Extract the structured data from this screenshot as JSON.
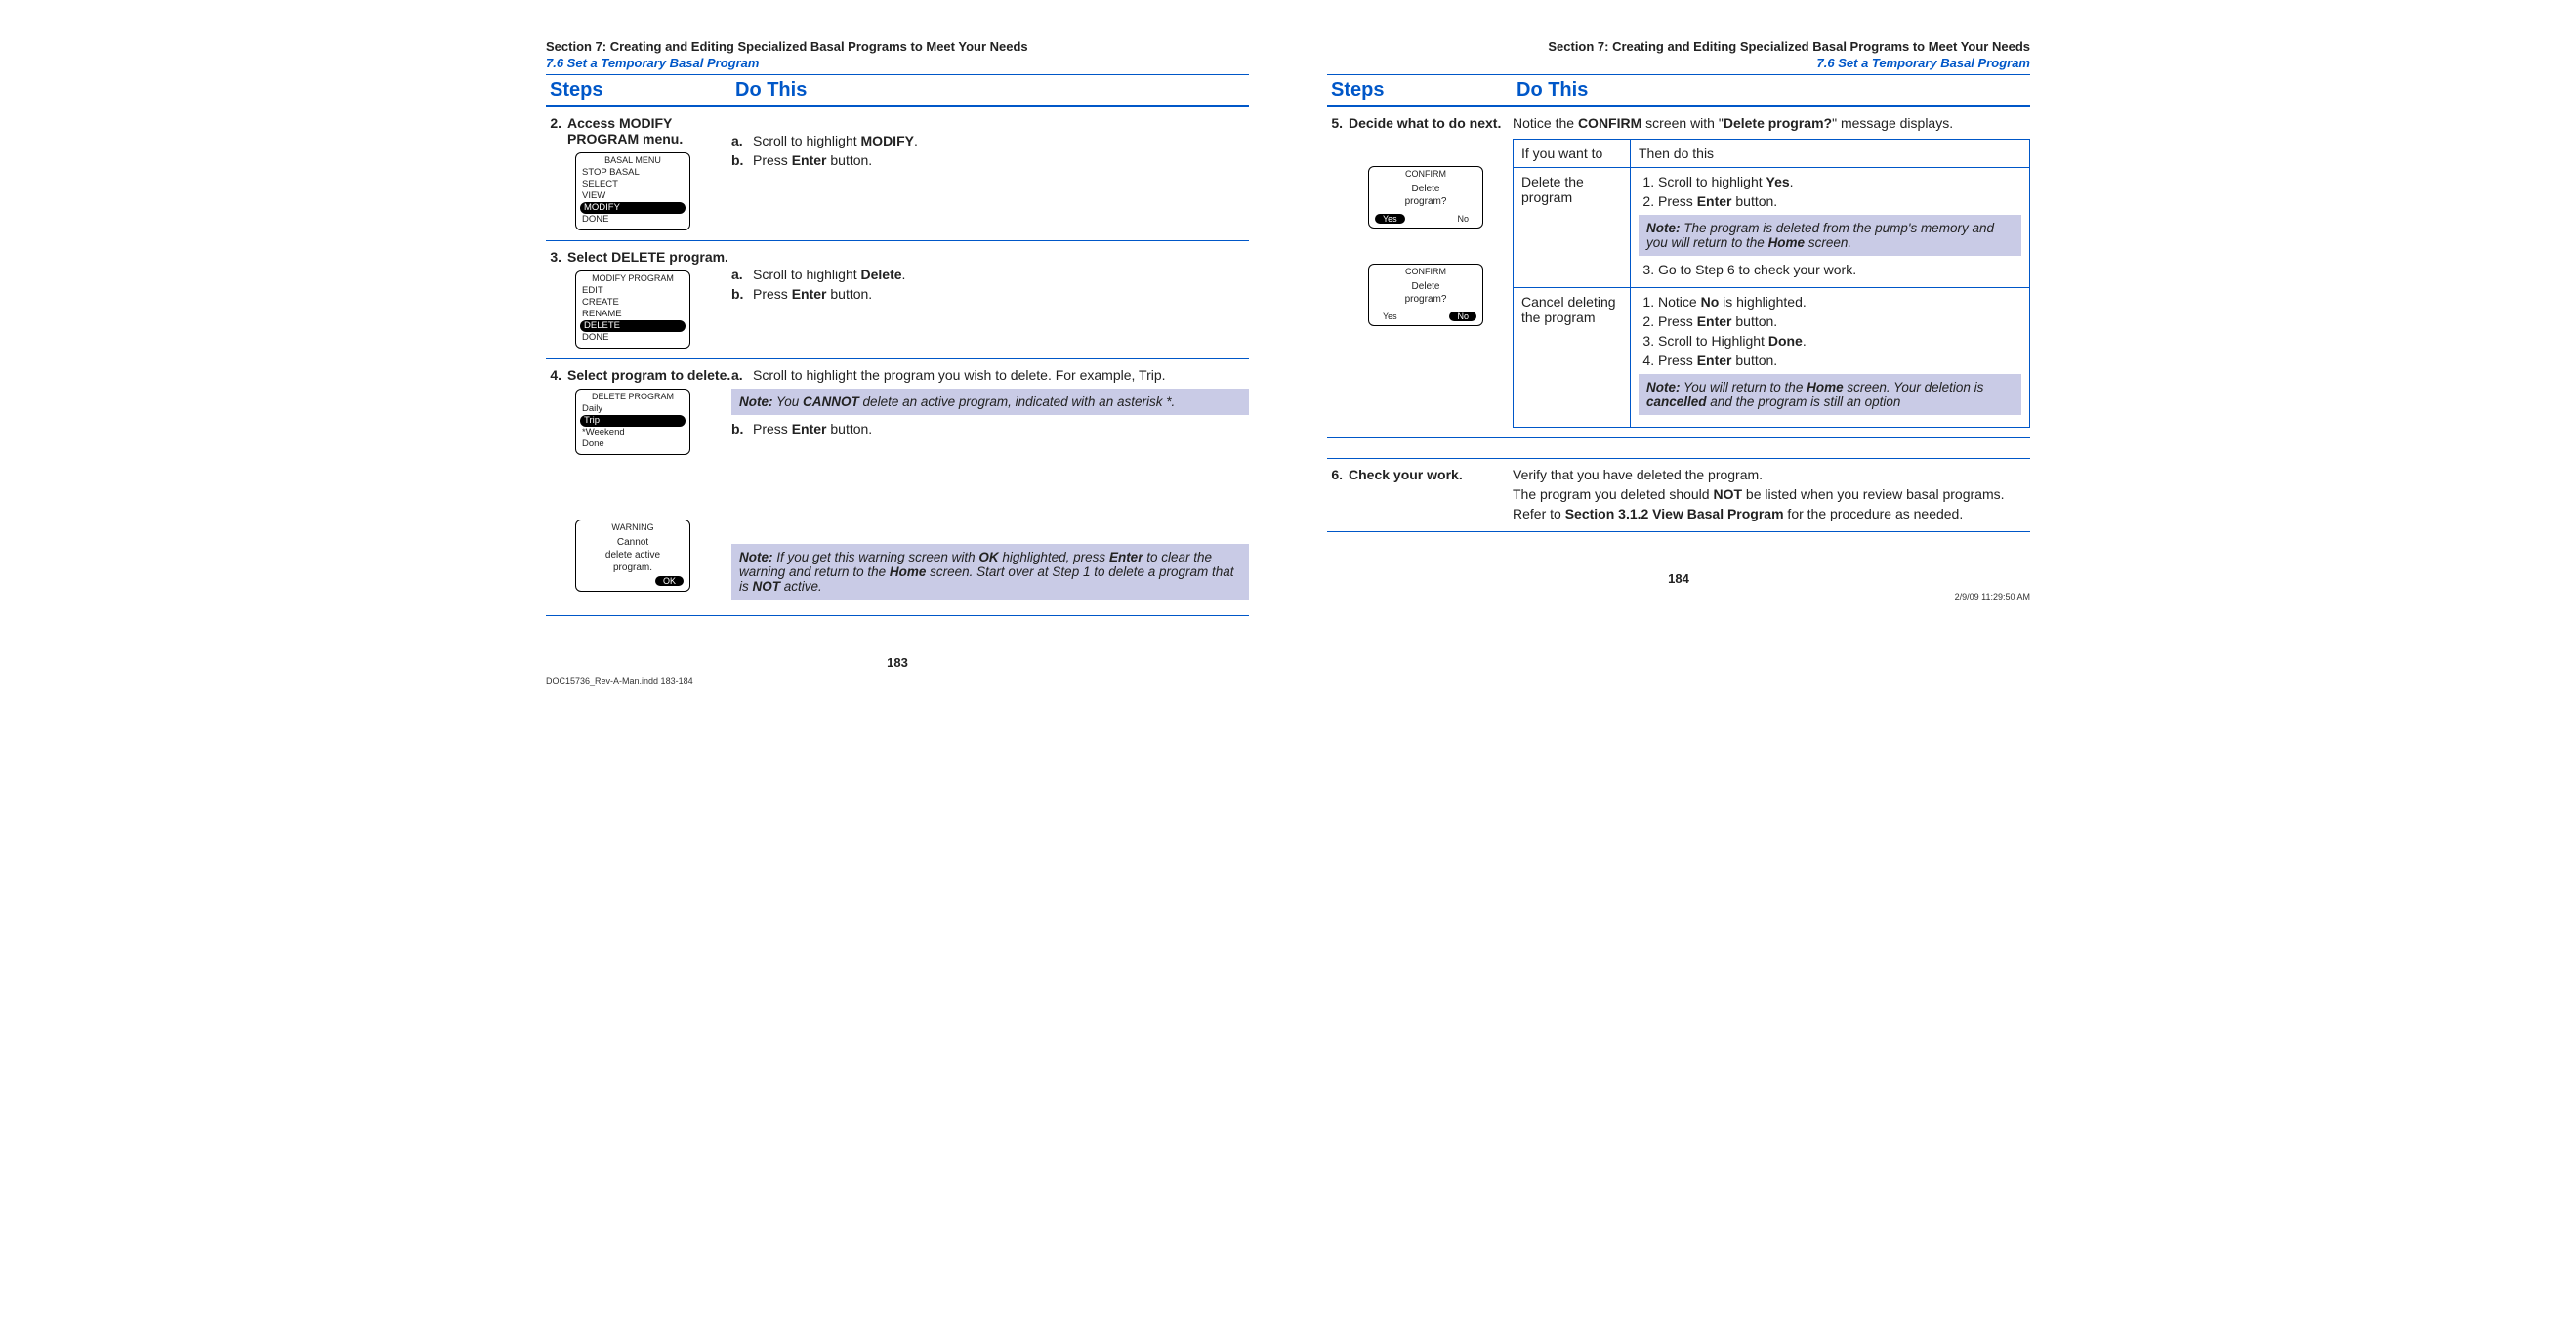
{
  "section_title": "Section 7: Creating and Editing Specialized Basal Programs to Meet Your Needs",
  "subsection": "7.6 Set a Temporary Basal Program",
  "headers": {
    "steps": "Steps",
    "dothis": "Do This"
  },
  "left": {
    "page_num": "183",
    "steps": [
      {
        "num": "2.",
        "title_pre": "Access ",
        "title_bold": "MODIFY PROGRAM",
        "title_post": " menu.",
        "device": {
          "title": "BASAL MENU",
          "items": [
            "STOP BASAL",
            "SELECT",
            "VIEW",
            "MODIFY",
            "DONE"
          ],
          "sel": "MODIFY"
        },
        "subs": [
          {
            "l": "a.",
            "pre": "Scroll to highlight ",
            "b": "MODIFY",
            "post": "."
          },
          {
            "l": "b.",
            "pre": "Press ",
            "b": "Enter",
            "post": " button."
          }
        ]
      },
      {
        "num": "3.",
        "title_pre": "Select ",
        "title_bold": "DELETE",
        "title_post": " program.",
        "device": {
          "title": "MODIFY PROGRAM",
          "items": [
            "EDIT",
            "CREATE",
            "RENAME",
            "DELETE",
            "DONE"
          ],
          "sel": "DELETE"
        },
        "subs": [
          {
            "l": "a.",
            "pre": "Scroll to highlight ",
            "b": "Delete",
            "post": "."
          },
          {
            "l": "b.",
            "pre": "Press ",
            "b": "Enter",
            "post": " button."
          }
        ]
      },
      {
        "num": "4.",
        "title_pre": "Select program to delete.",
        "title_bold": "",
        "title_post": "",
        "device": {
          "title": "DELETE PROGRAM",
          "items": [
            "Daily",
            "Trip",
            "*Weekend",
            "Done"
          ],
          "sel": "Trip"
        },
        "subs": [
          {
            "l": "a.",
            "pre": "Scroll to highlight the program you wish to delete. For example, Trip.",
            "b": "",
            "post": ""
          }
        ],
        "note1": {
          "label": "Note:",
          "t1": " You ",
          "b1": "CANNOT",
          "t2": " delete an active program, indicated with an asterisk *."
        },
        "sub_b": {
          "l": "b.",
          "pre": "Press ",
          "b": "Enter",
          "post": " button."
        },
        "warning_device": {
          "title": "WARNING",
          "lines": [
            "Cannot",
            "delete active",
            "program."
          ],
          "btn": "OK"
        },
        "note2": {
          "label": "Note:",
          "t1": " If you get this warning screen with ",
          "b1": "OK",
          "t2": " highlighted, press ",
          "b2": "Enter",
          "t3": " to clear the warning and return to the ",
          "b3": "Home",
          "t4": " screen. Start over at Step 1 to delete a program that is ",
          "b4": "NOT",
          "t5": " active."
        }
      }
    ]
  },
  "right": {
    "page_num": "184",
    "step5": {
      "num": "5.",
      "title": "Decide what to do next.",
      "intro_pre": "Notice the ",
      "intro_b1": "CONFIRM",
      "intro_mid": " screen with \"",
      "intro_b2": "Delete program?",
      "intro_post": "\" message displays.",
      "confirm1": {
        "title": "CONFIRM",
        "l1": "Delete",
        "l2": "program?",
        "yes": "Yes",
        "no": "No",
        "sel": "Yes"
      },
      "confirm2": {
        "title": "CONFIRM",
        "l1": "Delete",
        "l2": "program?",
        "yes": "Yes",
        "no": "No",
        "sel": "No"
      },
      "th1": "If you want to",
      "th2": "Then do this",
      "r1": {
        "want": "Delete the program",
        "li1_pre": "Scroll to highlight ",
        "li1_b": "Yes",
        "li1_post": ".",
        "li2_pre": "Press ",
        "li2_b": "Enter",
        "li2_post": " button.",
        "note_label": "Note:",
        "note_t1": " The program is deleted from the pump's memory and you will return to the ",
        "note_b": "Home",
        "note_t2": " screen.",
        "li3": "Go to Step 6 to check your work."
      },
      "r2": {
        "want": "Cancel deleting the program",
        "li1_pre": "Notice ",
        "li1_b": "No",
        "li1_post": " is highlighted.",
        "li2_pre": "Press ",
        "li2_b": "Enter",
        "li2_post": " button.",
        "li3_pre": "Scroll to Highlight ",
        "li3_b": "Done",
        "li3_post": ".",
        "li4_pre": "Press ",
        "li4_b": "Enter",
        "li4_post": " button.",
        "note_label": "Note:",
        "note_t1": " You will return to the ",
        "note_b1": "Home",
        "note_t2": " screen. Your deletion is ",
        "note_b2": "cancelled",
        "note_t3": " and the program is still an option"
      }
    },
    "step6": {
      "num": "6.",
      "title": "Check your work.",
      "l1": "Verify that you have deleted the program.",
      "l2_pre": "The program you deleted should ",
      "l2_b": "NOT",
      "l2_post": " be listed when you review basal programs.",
      "l3_pre": "Refer to ",
      "l3_b": "Section 3.1.2 View Basal Program",
      "l3_post": " for the procedure as needed."
    }
  },
  "footer": {
    "file": "DOC15736_Rev-A-Man.indd   183-184",
    "date": "2/9/09   11:29:50 AM"
  }
}
